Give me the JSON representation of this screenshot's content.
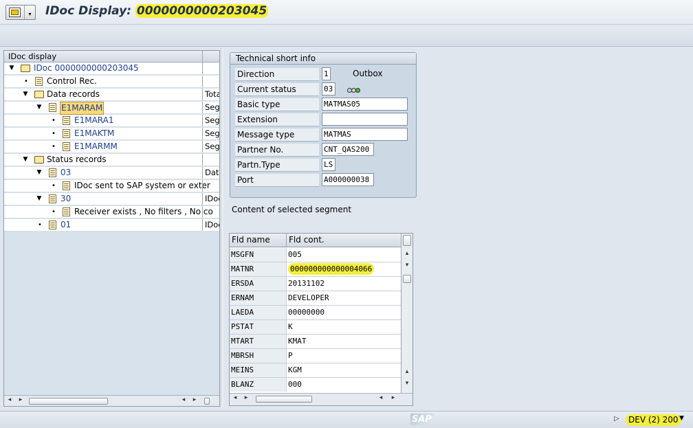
{
  "window": {
    "title_prefix": "IDoc Display: ",
    "title_number": "0000000000203045",
    "title_highlight_color": "#f7ef3a"
  },
  "tree": {
    "header": "IDoc display",
    "rows": [
      {
        "label": "IDoc 0000000000203045",
        "col2": "",
        "type": "folder",
        "expand": "▼"
      },
      {
        "label": "Control Rec.",
        "col2": "",
        "type": "doc",
        "expand": "•"
      },
      {
        "label": "Data records",
        "col2": "Tota",
        "type": "folder",
        "expand": "▼"
      },
      {
        "label": "E1MARAM",
        "col2": "Segr",
        "type": "doc",
        "expand": "▼"
      },
      {
        "label": "E1MARA1",
        "col2": "Segr",
        "type": "doc",
        "expand": "•"
      },
      {
        "label": "E1MAKTM",
        "col2": "Segr",
        "type": "doc",
        "expand": "•"
      },
      {
        "label": "E1MARMM",
        "col2": "Segr",
        "type": "doc",
        "expand": "•"
      },
      {
        "label": "Status records",
        "col2": "",
        "type": "folder",
        "expand": "▼"
      },
      {
        "label": "03",
        "col2": "Data",
        "type": "doc",
        "expand": "▼"
      },
      {
        "label": "IDoc sent to SAP system or exter",
        "col2": "",
        "type": "doc",
        "expand": "•"
      },
      {
        "label": "30",
        "col2": "IDoc",
        "type": "doc",
        "expand": "▼"
      },
      {
        "label": "Receiver exists , No filters , No co",
        "col2": "",
        "type": "doc",
        "expand": "•"
      },
      {
        "label": "01",
        "col2": "IDoc",
        "type": "doc",
        "expand": "•"
      }
    ]
  },
  "tech_info": {
    "header": "Technical short info",
    "direction": {
      "label": "Direction",
      "value": "1",
      "text": "Outbox"
    },
    "current_status": {
      "label": "Current status",
      "value": "03",
      "lights": "green"
    },
    "basic_type": {
      "label": "Basic type",
      "value": "MATMAS05"
    },
    "extension": {
      "label": "Extension",
      "value": ""
    },
    "message_type": {
      "label": "Message type",
      "value": "MATMAS"
    },
    "partner_no": {
      "label": "Partner No.",
      "value": "CNT_QAS200"
    },
    "partner_type": {
      "label": "Partn.Type",
      "value": "LS"
    },
    "port": {
      "label": "Port",
      "value": "A000000038"
    }
  },
  "segment": {
    "label": "Content of selected segment",
    "col1": "Fld name",
    "col2": "Fld cont.",
    "rows": [
      {
        "name": "MSGFN",
        "value": "005"
      },
      {
        "name": "MATNR",
        "value": "000000000000004066"
      },
      {
        "name": "ERSDA",
        "value": "20131102"
      },
      {
        "name": "ERNAM",
        "value": "DEVELOPER"
      },
      {
        "name": "LAEDA",
        "value": "00000000"
      },
      {
        "name": "PSTAT",
        "value": "K"
      },
      {
        "name": "MTART",
        "value": "KMAT"
      },
      {
        "name": "MBRSH",
        "value": "P"
      },
      {
        "name": "MEINS",
        "value": "KGM"
      },
      {
        "name": "BLANZ",
        "value": "000"
      }
    ]
  },
  "status_bar": {
    "logo": "SAP",
    "system": "DEV (2) 200"
  }
}
